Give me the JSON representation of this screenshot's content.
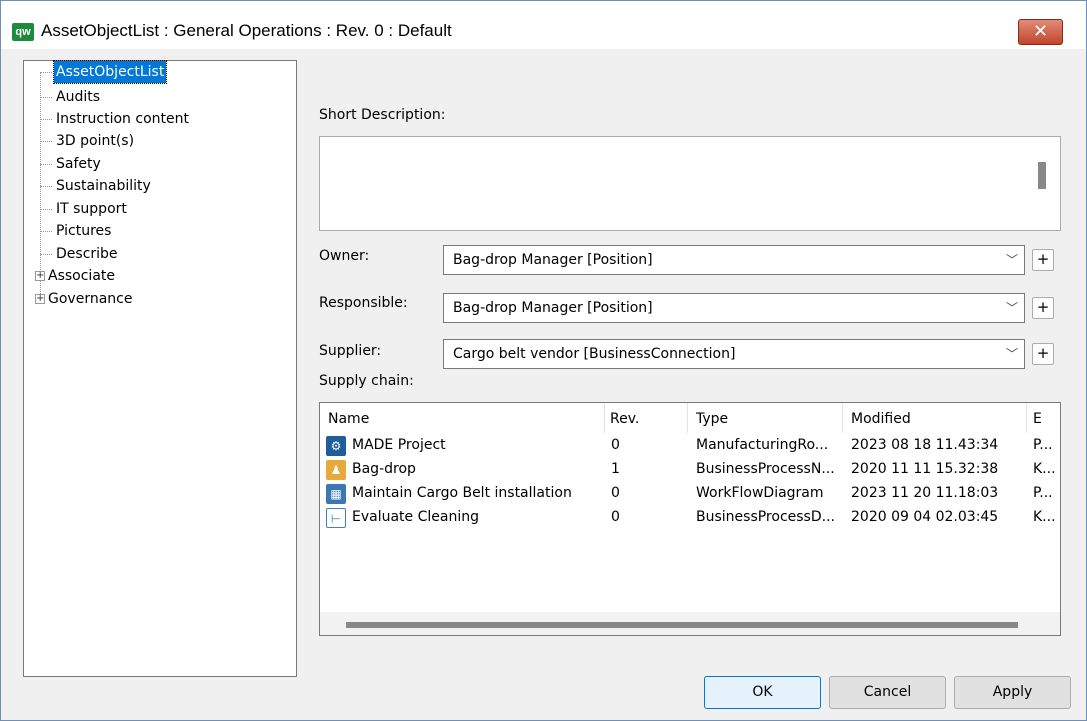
{
  "window": {
    "title": "AssetObjectList : General Operations : Rev. 0  : Default",
    "logo_text": "qw",
    "close_glyph": "✕"
  },
  "tree": {
    "items": [
      {
        "label": "AssetObjectList",
        "selected": true
      },
      {
        "label": "Audits"
      },
      {
        "label": "Instruction content"
      },
      {
        "label": "3D point(s)"
      },
      {
        "label": "Safety"
      },
      {
        "label": "Sustainability"
      },
      {
        "label": "IT support"
      },
      {
        "label": "Pictures"
      },
      {
        "label": "Describe"
      },
      {
        "label": "Associate",
        "expandable": true
      },
      {
        "label": "Governance",
        "expandable": true
      }
    ],
    "expander_glyph": "+"
  },
  "form": {
    "short_description_label": "Short Description:",
    "short_description_value": "",
    "owner_label": "Owner:",
    "owner_value": "Bag-drop Manager [Position]",
    "responsible_label": "Responsible:",
    "responsible_value": "Bag-drop Manager [Position]",
    "supplier_label": "Supplier:",
    "supplier_value": "Cargo belt vendor [BusinessConnection]",
    "supply_chain_label": "Supply chain:",
    "dropdown_glyph": "﹀",
    "plus_glyph": "+"
  },
  "grid": {
    "columns": [
      "Name",
      "Rev.",
      "Type",
      "Modified",
      "E"
    ],
    "rows": [
      {
        "name": "MADE Project",
        "rev": "0",
        "type": "ManufacturingRo...",
        "modified": "2023 08 18 11.43:34",
        "extra": "P...",
        "icon": "manufacturing-icon",
        "icon_color": "#1f5d9c"
      },
      {
        "name": "Bag-drop",
        "rev": "1",
        "type": "BusinessProcessN...",
        "modified": "2020 11 11 15.32:38",
        "extra": "K...",
        "icon": "business-process-network-icon",
        "icon_color": "#e8a93c"
      },
      {
        "name": "Maintain Cargo Belt installation",
        "rev": "0",
        "type": "WorkFlowDiagram",
        "modified": "2023 11 20 11.18:03",
        "extra": "P...",
        "icon": "workflow-diagram-icon",
        "icon_color": "#3c79b4"
      },
      {
        "name": "Evaluate Cleaning",
        "rev": "0",
        "type": "BusinessProcessD...",
        "modified": "2020 09 04 02.03:45",
        "extra": "K...",
        "icon": "business-process-diagram-icon",
        "icon_color": "#ffffff"
      }
    ]
  },
  "buttons": {
    "ok": "OK",
    "cancel": "Cancel",
    "apply": "Apply"
  }
}
